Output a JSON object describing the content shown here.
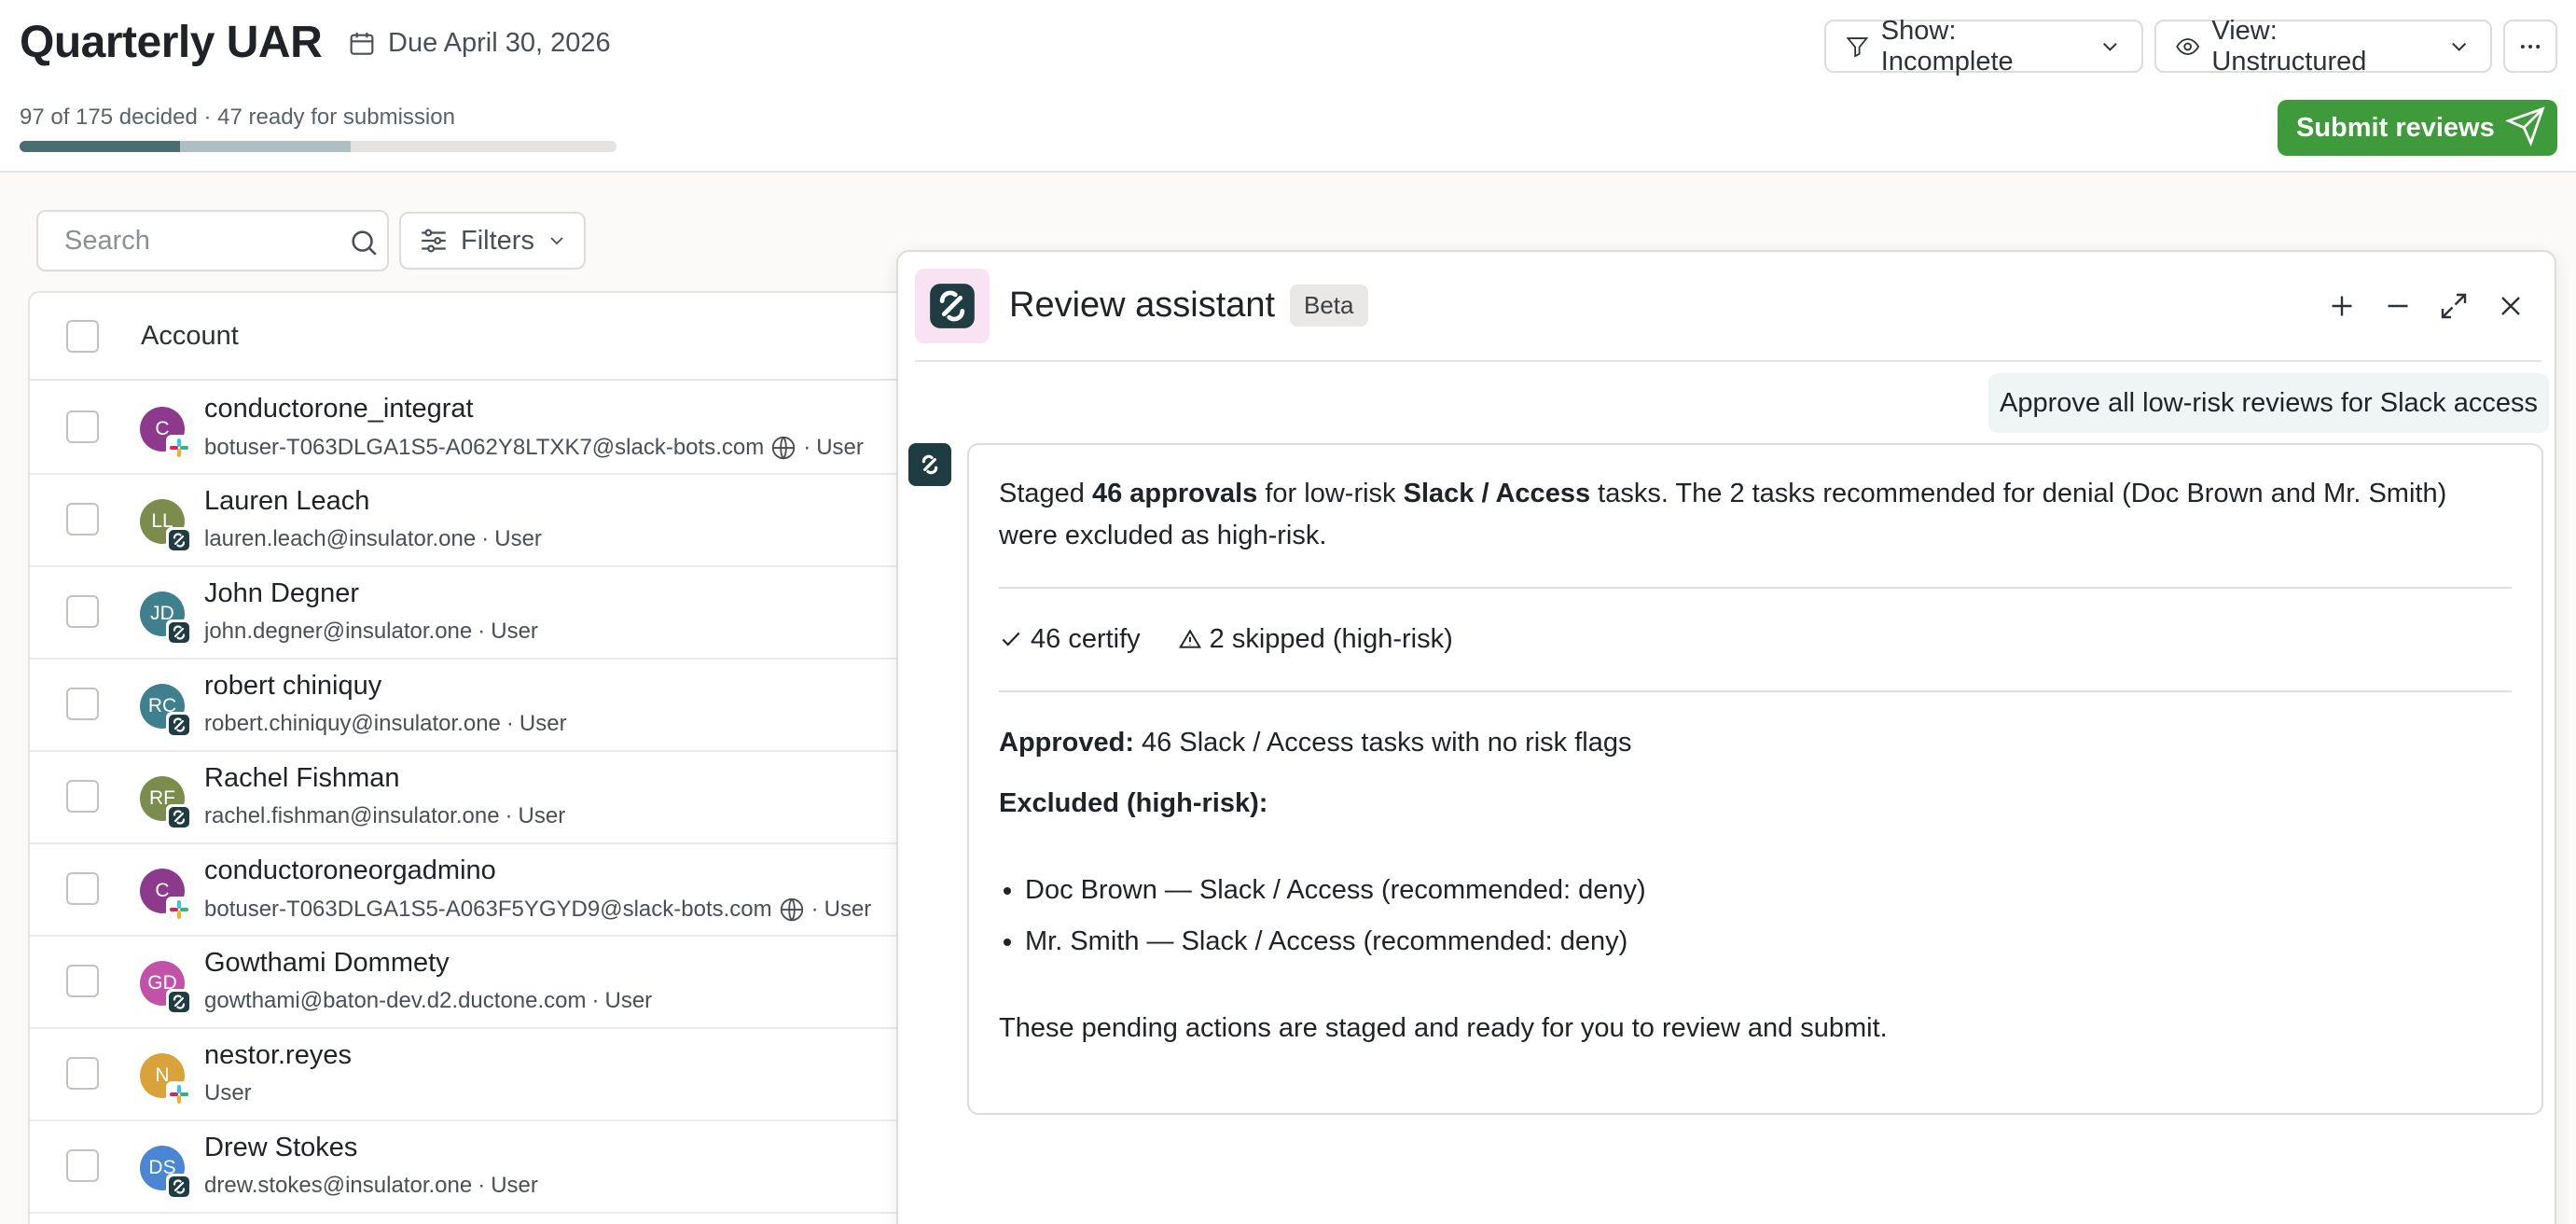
{
  "header": {
    "title": "Quarterly UAR",
    "due": "Due April 30, 2026",
    "progress_text": "97 of 175 decided · 47 ready for submission",
    "progress": {
      "total": 175,
      "decided": 97,
      "ready": 47
    },
    "show_filter": "Show: Incomplete",
    "view_select": "View: Unstructured",
    "submit_label": "Submit reviews",
    "colors": {
      "submit": "#3e9a3a",
      "progress_ready": "#4a6d72",
      "progress_decided": "#aebfc1"
    }
  },
  "toolbar": {
    "search_placeholder": "Search",
    "filters_label": "Filters"
  },
  "table": {
    "column_account": "Account",
    "rows": [
      {
        "initials": "C",
        "avatar_color": "#8e3a8c",
        "badge": "slack-icon",
        "name": "conductorone_integrat",
        "email": "botuser-T063DLGA1S5-A062Y8LTXK7@slack-bots.com",
        "globe": true,
        "type": "User"
      },
      {
        "initials": "LL",
        "avatar_color": "#7b8c4d",
        "badge": "conductorone-icon",
        "name": "Lauren Leach",
        "email": "lauren.leach@insulator.one",
        "globe": false,
        "type": "User"
      },
      {
        "initials": "JD",
        "avatar_color": "#3f7f8e",
        "badge": "conductorone-icon",
        "name": "John Degner",
        "email": "john.degner@insulator.one",
        "globe": false,
        "type": "User"
      },
      {
        "initials": "RC",
        "avatar_color": "#3f7f8e",
        "badge": "conductorone-icon",
        "name": "robert chiniquy",
        "email": "robert.chiniquy@insulator.one",
        "globe": false,
        "type": "User"
      },
      {
        "initials": "RF",
        "avatar_color": "#7b8c4d",
        "badge": "conductorone-icon",
        "name": "Rachel Fishman",
        "email": "rachel.fishman@insulator.one",
        "globe": false,
        "type": "User"
      },
      {
        "initials": "C",
        "avatar_color": "#8e3a8c",
        "badge": "slack-icon",
        "name": "conductoroneorgadmino",
        "email": "botuser-T063DLGA1S5-A063F5YGYD9@slack-bots.com",
        "globe": true,
        "type": "User"
      },
      {
        "initials": "GD",
        "avatar_color": "#c052a8",
        "badge": "conductorone-icon",
        "name": "Gowthami Dommety",
        "email": "gowthami@baton-dev.d2.ductone.com",
        "globe": false,
        "type": "User"
      },
      {
        "initials": "N",
        "avatar_color": "#d9a23a",
        "badge": "slack-icon",
        "name": "nestor.reyes",
        "email": "",
        "globe": false,
        "type": "User"
      },
      {
        "initials": "DS",
        "avatar_color": "#4a86d4",
        "badge": "conductorone-icon",
        "name": "Drew Stokes",
        "email": "drew.stokes@insulator.one",
        "globe": false,
        "type": "User"
      }
    ]
  },
  "assistant": {
    "title": "Review assistant",
    "badge": "Beta",
    "user_message": "Approve all low-risk reviews for Slack access",
    "response": {
      "p1_a": "Staged ",
      "p1_b": "46 approvals",
      "p1_c": " for low-risk ",
      "p1_d": "Slack / Access",
      "p1_e": " tasks. The 2 tasks recommended for denial (Doc Brown and Mr. Smith) were excluded as high-risk.",
      "stat_certify": "46 certify",
      "stat_skipped": "2 skipped (high-risk)",
      "approved_label": "Approved:",
      "approved_text": " 46 Slack / Access tasks with no risk flags",
      "excluded_label": "Excluded (high-risk):",
      "excluded_items": [
        "Doc Brown — Slack / Access (recommended: deny)",
        "Mr. Smith — Slack / Access (recommended: deny)"
      ],
      "closing": "These pending actions are staged and ready for you to review and submit."
    }
  }
}
